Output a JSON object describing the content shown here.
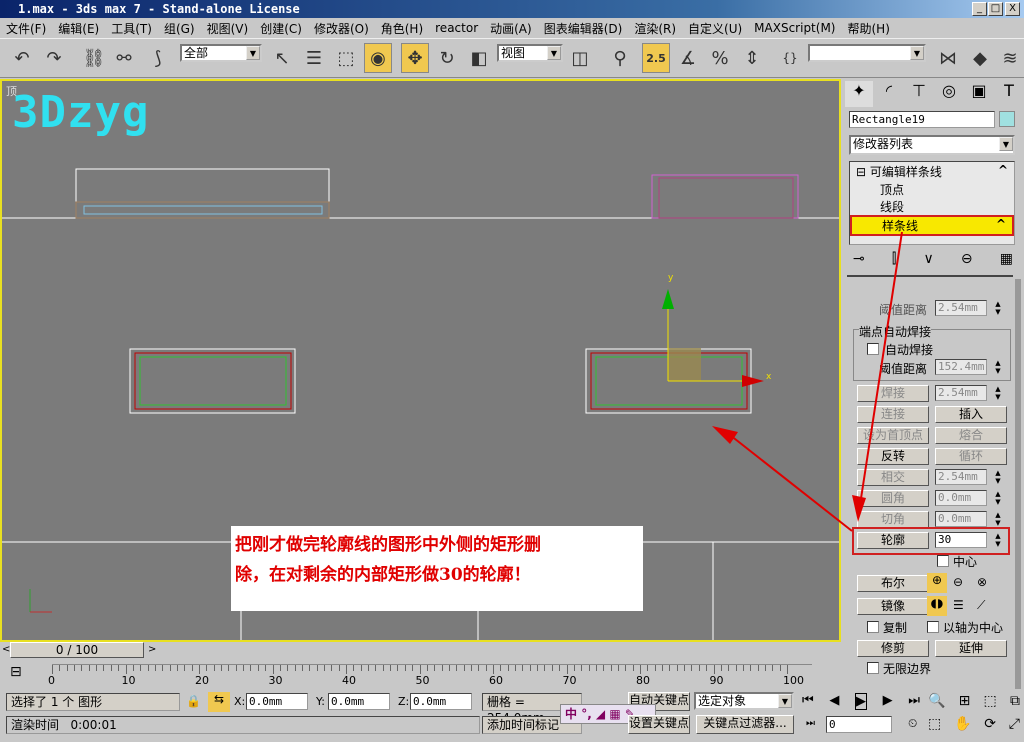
{
  "window": {
    "title": "1.max - 3ds max 7  - Stand-alone License",
    "min": "_",
    "max": "□",
    "close": "X"
  },
  "menu": [
    "文件(F)",
    "编辑(E)",
    "工具(T)",
    "组(G)",
    "视图(V)",
    "创建(C)",
    "修改器(O)",
    "角色(H)",
    "reactor",
    "动画(A)",
    "图表编辑器(D)",
    "渲染(R)",
    "自定义(U)",
    "MAXScript(M)",
    "帮助(H)"
  ],
  "toolbar": {
    "selection_filter": "全部",
    "reference_coord": "视图",
    "snap_value": "2.5",
    "named_selection": ""
  },
  "viewport": {
    "label": "顶",
    "watermark": "3Dzyg",
    "annotation_line1": "把刚才做完轮廓线的图形中外侧的矩形删",
    "annotation_line2": "除，在对剩余的内部矩形做30的轮廓！",
    "gizmo_x": "x",
    "gizmo_y": "y"
  },
  "panel": {
    "object_name": "Rectangle19",
    "object_color": "#a0e0e0",
    "modifier_list": "修改器列表",
    "stack": {
      "root": "可编辑样条线",
      "items": [
        "顶点",
        "线段",
        "样条线"
      ],
      "selected": "样条线"
    },
    "threshold_label": "阈值距离",
    "threshold_value": "2.54mm",
    "endpoint_group": "端点自动焊接",
    "auto_weld": "自动焊接",
    "weld_threshold": "152.4mm",
    "weld": "焊接",
    "weld_value": "2.54mm",
    "connect": "连接",
    "insert": "插入",
    "make_first": "设为首顶点",
    "fuse": "熔合",
    "reverse": "反转",
    "cycle": "循环",
    "intersect": "相交",
    "intersect_value": "2.54mm",
    "fillet": "圆角",
    "fillet_value": "0.0mm",
    "chamfer": "切角",
    "chamfer_value": "0.0mm",
    "outline": "轮廓",
    "outline_value": "30",
    "center": "中心",
    "boolean": "布尔",
    "mirror": "镜像",
    "copy": "复制",
    "about_pivot": "以轴为中心",
    "trim": "修剪",
    "extend": "延伸",
    "infinite_bounds": "无限边界"
  },
  "timeline": {
    "frame": "0 / 100",
    "ticks": [
      "0",
      "10",
      "20",
      "30",
      "40",
      "50",
      "60",
      "70",
      "80",
      "90",
      "100"
    ]
  },
  "status": {
    "selection": "选择了 1 个 图形",
    "x": "0.0mm",
    "y": "0.0mm",
    "z": "0.0mm",
    "grid": "栅格 = 254.0mm",
    "auto_key": "自动关键点",
    "set_key": "设置关键点",
    "key_mode": "选定对象",
    "key_filters": "关键点过滤器...",
    "render_time_label": "渲染时间",
    "render_time": "0:00:01",
    "add_time_tag": "添加时间标记",
    "current_frame": "0",
    "ime": "中",
    "x_label": "X:",
    "y_label": "Y:",
    "z_label": "Z:"
  }
}
